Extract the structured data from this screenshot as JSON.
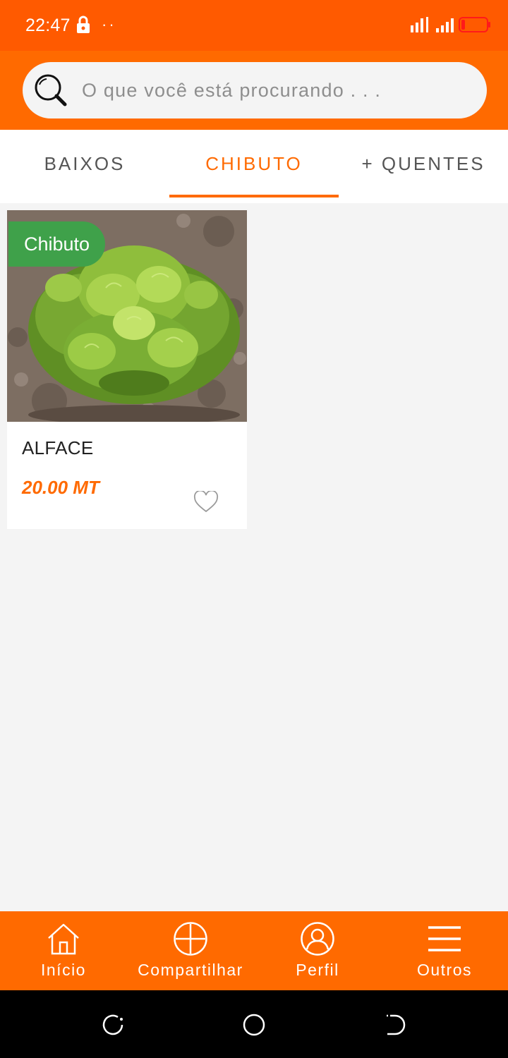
{
  "status_bar": {
    "time": "22:47",
    "dots": "··"
  },
  "search": {
    "placeholder": "O que você está procurando . . ."
  },
  "tabs": [
    {
      "label": "BAIXOS"
    },
    {
      "label": "CHIBUTO"
    },
    {
      "label": "+ QUENTES"
    }
  ],
  "active_tab": "CHIBUTO",
  "product": {
    "badge": "Chibuto",
    "name": "ALFACE",
    "price": "20.00 MT"
  },
  "bottom_nav": [
    {
      "label": "Início",
      "icon": "home-icon"
    },
    {
      "label": "Compartilhar",
      "icon": "plus-circle-icon"
    },
    {
      "label": "Perfil",
      "icon": "user-circle-icon"
    },
    {
      "label": "Outros",
      "icon": "menu-icon"
    }
  ],
  "colors": {
    "accent": "#ff6a00",
    "status_bar": "#ff5a00",
    "badge": "#3fa14a",
    "background": "#f4f4f4"
  }
}
